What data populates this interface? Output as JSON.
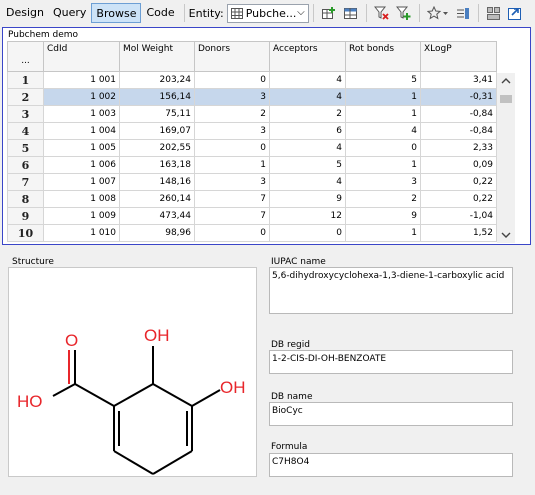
{
  "toolbar": {
    "tabs": [
      {
        "label": "Design",
        "active": false
      },
      {
        "label": "Query",
        "active": false
      },
      {
        "label": "Browse",
        "active": true
      },
      {
        "label": "Code",
        "active": false
      }
    ],
    "entity_label": "Entity:",
    "entity_value": "Pubche...",
    "icons": [
      "add-row-icon",
      "table-icon",
      "filter-red-icon",
      "filter-green-icon",
      "star-icon",
      "list-settings-icon",
      "form-layout-icon",
      "export-icon"
    ]
  },
  "grid": {
    "caption": "Pubchem demo",
    "corner": "...",
    "columns": [
      "CdId",
      "Mol Weight",
      "Donors",
      "Acceptors",
      "Rot bonds",
      "XLogP"
    ],
    "rows": [
      {
        "n": "1",
        "cdid": "1 001",
        "mw": "203,24",
        "donors": "0",
        "acceptors": "4",
        "rot": "5",
        "xlogp": "3,41"
      },
      {
        "n": "2",
        "cdid": "1 002",
        "mw": "156,14",
        "donors": "3",
        "acceptors": "4",
        "rot": "1",
        "xlogp": "-0,31"
      },
      {
        "n": "3",
        "cdid": "1 003",
        "mw": "75,11",
        "donors": "2",
        "acceptors": "2",
        "rot": "1",
        "xlogp": "-0,84"
      },
      {
        "n": "4",
        "cdid": "1 004",
        "mw": "169,07",
        "donors": "3",
        "acceptors": "6",
        "rot": "4",
        "xlogp": "-0,84"
      },
      {
        "n": "5",
        "cdid": "1 005",
        "mw": "202,55",
        "donors": "0",
        "acceptors": "4",
        "rot": "0",
        "xlogp": "2,33"
      },
      {
        "n": "6",
        "cdid": "1 006",
        "mw": "163,18",
        "donors": "1",
        "acceptors": "5",
        "rot": "1",
        "xlogp": "0,09"
      },
      {
        "n": "7",
        "cdid": "1 007",
        "mw": "148,16",
        "donors": "3",
        "acceptors": "4",
        "rot": "3",
        "xlogp": "0,22"
      },
      {
        "n": "8",
        "cdid": "1 008",
        "mw": "260,14",
        "donors": "7",
        "acceptors": "9",
        "rot": "2",
        "xlogp": "0,22"
      },
      {
        "n": "9",
        "cdid": "1 009",
        "mw": "473,44",
        "donors": "7",
        "acceptors": "12",
        "rot": "9",
        "xlogp": "-1,04"
      },
      {
        "n": "10",
        "cdid": "1 010",
        "mw": "98,96",
        "donors": "0",
        "acceptors": "0",
        "rot": "1",
        "xlogp": "1,52"
      }
    ],
    "selected_row": 1
  },
  "structure": {
    "label": "Structure",
    "atoms": [
      "O",
      "HO",
      "OH",
      "OH"
    ]
  },
  "fields": [
    {
      "label": "IUPAC name",
      "value": "5,6-dihydroxycyclohexa-1,3-diene-1-carboxylic acid"
    },
    {
      "label": "DB regid",
      "value": "1-2-CIS-DI-OH-BENZOATE"
    },
    {
      "label": "DB name",
      "value": "BioCyc"
    },
    {
      "label": "Formula",
      "value": "C7H8O4"
    }
  ],
  "colors": {
    "selection": "#c6d7ec",
    "grid_border": "#3a46c8",
    "oxygen": "#e8262b"
  }
}
